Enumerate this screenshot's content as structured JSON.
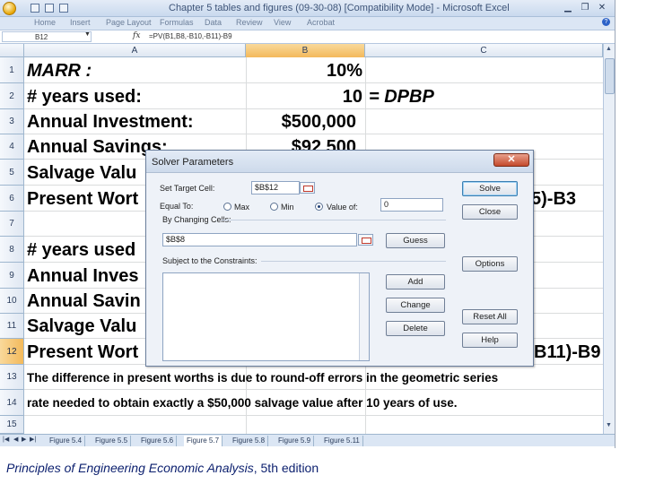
{
  "window": {
    "title": "Chapter 5 tables and figures (09-30-08)  [Compatibility Mode]  -  Microsoft Excel",
    "buttons": [
      "▁",
      "❐",
      "✕"
    ]
  },
  "menu": {
    "tabs": [
      "Home",
      "Insert",
      "Page Layout",
      "Formulas",
      "Data",
      "Review",
      "View",
      "Acrobat"
    ]
  },
  "formula_bar": {
    "name_box": "B12",
    "fx": "fx",
    "formula": "=PV(B1,B8,-B10,-B11)-B9"
  },
  "columns": [
    "A",
    "B",
    "C"
  ],
  "rows": [
    "1",
    "2",
    "3",
    "4",
    "5",
    "6",
    "7",
    "8",
    "9",
    "10",
    "11",
    "12",
    "13",
    "14",
    "15"
  ],
  "selected_row": "12",
  "cells": {
    "a1": "MARR :",
    "b1": "10%",
    "a2": "# years used:",
    "b2": "10",
    "c2": "= DPBP",
    "a3": "Annual Investment:",
    "b3": "$500,000",
    "a4": "Annual Savings:",
    "b4": "$92,500",
    "a5": "Salvage Valu",
    "a6": "Present Wort",
    "c6": "5)-B3",
    "a8": "# years used",
    "a9": "Annual Inves",
    "a10": "Annual Savin",
    "a11": "Salvage Valu",
    "a12": "Present Wort",
    "c12": "B11)-B9",
    "a13": "The difference in present worths is due to round-off errors in the geometric series",
    "a14": "rate needed to obtain exactly a $50,000 salvage value after 10 years of use."
  },
  "sheet_tabs": [
    "Figure 5.4",
    "Figure 5.5",
    "Figure 5.6",
    "Figure 5.7",
    "Figure 5.8",
    "Figure 5.9",
    "Figure 5.11"
  ],
  "active_sheet_tab": "Figure 5.7",
  "solver": {
    "title": "Solver Parameters",
    "close": "✕",
    "set_target_label": "Set Target Cell:",
    "set_target_value": "$B$12",
    "equal_to_label": "Equal To:",
    "radio_max": "Max",
    "radio_min": "Min",
    "radio_value": "Value of:",
    "value_of": "0",
    "changing_label": "By Changing Cells:",
    "changing_value": "$B$8",
    "constraints_label": "Subject to the Constraints:",
    "buttons": {
      "solve": "Solve",
      "close": "Close",
      "guess": "Guess",
      "options": "Options",
      "add": "Add",
      "change": "Change",
      "delete": "Delete",
      "reset_all": "Reset All",
      "help": "Help"
    }
  },
  "footer": {
    "book_title": "Principles of Engineering Economic Analysis",
    "edition": ", 5th edition"
  }
}
